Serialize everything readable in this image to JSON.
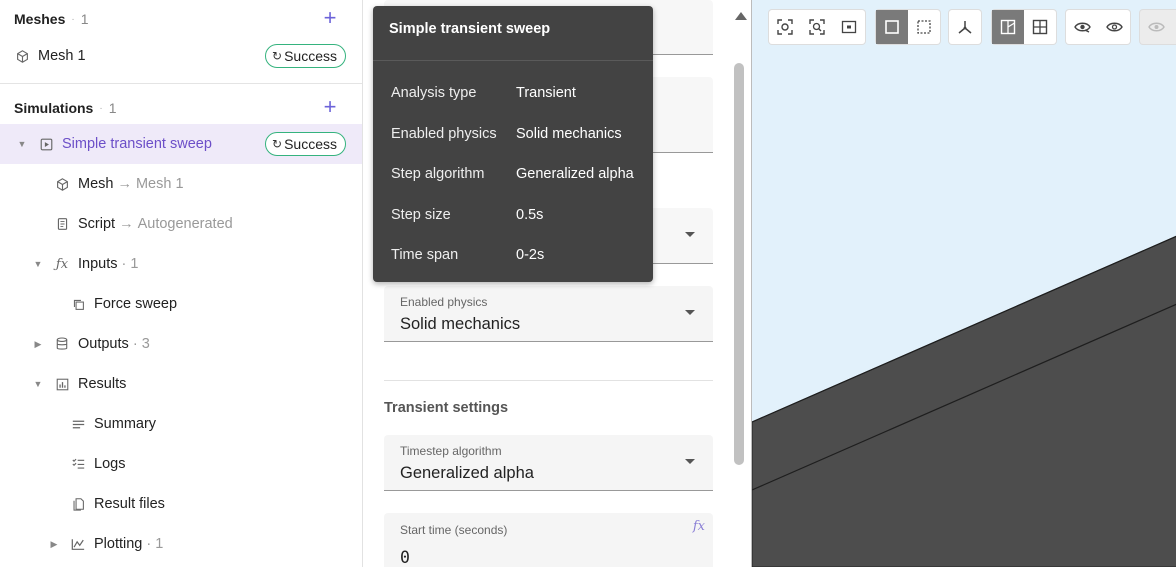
{
  "sidebar": {
    "meshes": {
      "title": "Meshes",
      "count": "1",
      "items": [
        {
          "label": "Mesh 1",
          "status": "Success"
        }
      ]
    },
    "simulations": {
      "title": "Simulations",
      "count": "1",
      "items": [
        {
          "label": "Simple transient sweep",
          "status": "Success"
        }
      ]
    },
    "tree": {
      "mesh": {
        "label": "Mesh",
        "ref": "Mesh 1"
      },
      "script": {
        "label": "Script",
        "ref": "Autogenerated"
      },
      "inputs": {
        "label": "Inputs",
        "count": "1"
      },
      "force_sweep": {
        "label": "Force sweep"
      },
      "outputs": {
        "label": "Outputs",
        "count": "3"
      },
      "results": {
        "label": "Results"
      },
      "summary": {
        "label": "Summary"
      },
      "logs": {
        "label": "Logs"
      },
      "result_files": {
        "label": "Result files"
      },
      "plotting": {
        "label": "Plotting",
        "count": "1"
      }
    },
    "separator": "·",
    "arrow": "→"
  },
  "form": {
    "enabled_physics": {
      "label": "Enabled physics",
      "value": "Solid mechanics"
    },
    "transient_settings_title": "Transient settings",
    "timestep_algorithm": {
      "label": "Timestep algorithm",
      "value": "Generalized alpha"
    },
    "start_time": {
      "label": "Start time (seconds)",
      "value": "0",
      "fx": "fx"
    }
  },
  "tooltip": {
    "title": "Simple transient sweep",
    "rows": [
      {
        "key": "Analysis type",
        "value": "Transient"
      },
      {
        "key": "Enabled physics",
        "value": "Solid mechanics"
      },
      {
        "key": "Step algorithm",
        "value": "Generalized alpha"
      },
      {
        "key": "Step size",
        "value": "0.5s"
      },
      {
        "key": "Time span",
        "value": "0-2s"
      }
    ]
  },
  "viewport": {
    "background": "#e2f1fb",
    "beam_color": "#4d4d4d"
  },
  "colors": {
    "accent": "#6c63d9",
    "success_border": "#35b37e",
    "selected_bg": "#efeaf9",
    "selected_text": "#6c4fc8"
  }
}
